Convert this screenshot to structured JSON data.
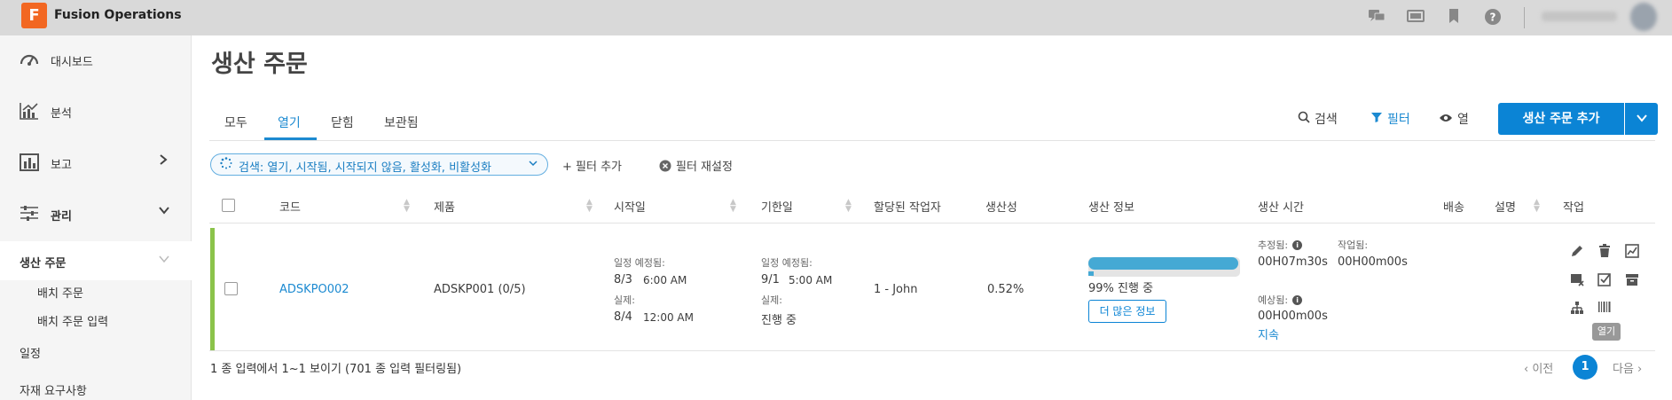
{
  "app": {
    "logo_letter": "F",
    "title": "Fusion Operations"
  },
  "topbar": {
    "icons": [
      "chat-icon",
      "screen-icon",
      "bookmark-icon",
      "help-icon"
    ]
  },
  "sidebar": {
    "items": [
      {
        "label": "대시보드",
        "icon": "gauge-icon"
      },
      {
        "label": "분석",
        "icon": "analytics-icon"
      },
      {
        "label": "보고",
        "icon": "report-icon"
      },
      {
        "label": "관리",
        "icon": "sliders-icon"
      }
    ],
    "active_label": "생산 주문",
    "sub_items": [
      "배치 주문",
      "배치 주문 입력"
    ],
    "more_items": [
      "일정",
      "자재 요구사항"
    ]
  },
  "page": {
    "title": "생산 주문"
  },
  "tabs": [
    "모두",
    "열기",
    "닫힘",
    "보관됨"
  ],
  "toolbar": {
    "search": "검색",
    "filter": "필터",
    "columns": "열",
    "add_button": "생산 주문 추가"
  },
  "filters": {
    "active_filter": "검색: 열기, 시작됨, 시작되지 않음, 활성화, 비활성화",
    "add_filter": "+ 필터 추가",
    "reset_filter": "필터 재설정"
  },
  "table": {
    "headers": [
      "코드",
      "제품",
      "시작일",
      "기한일",
      "할당된 작업자",
      "생산성",
      "생산 정보",
      "생산 시간",
      "배송",
      "설명",
      "작업"
    ],
    "row": {
      "code": "ADSKPO002",
      "product": "ADSKP001 (0/5)",
      "start": {
        "sched_label": "일정 예정됨:",
        "sched_date": "8/3",
        "sched_time": "6:00 AM",
        "actual_label": "실제:",
        "actual_date": "8/4",
        "actual_time": "12:00 AM"
      },
      "due": {
        "sched_label": "일정 예정됨:",
        "sched_date": "9/1",
        "sched_time": "5:00 AM",
        "actual_label": "실제:",
        "actual_value": "진행 중"
      },
      "assignee": "1 - John",
      "productivity": "0.52%",
      "production_info": {
        "progress_percent": 99,
        "progress_text": "99% 진행 중",
        "more_button": "더 많은 정보"
      },
      "production_time": {
        "estimated_label": "추정됨:",
        "estimated": "00H07m30s",
        "worked_label": "작업됨:",
        "worked": "00H00m00s",
        "expected_label": "예상됨:",
        "expected": "00H00m00s",
        "continue_link": "지속"
      },
      "tooltip": "열기"
    }
  },
  "footer": {
    "summary": "1 종 입력에서 1~1 보이기 (701 종 입력 필터링됨)",
    "prev": "‹ 이전",
    "page": "1",
    "next": "다음 ›"
  },
  "colors": {
    "accent": "#0b84d5",
    "row_status": "#8bc34a",
    "logo": "#f26722"
  }
}
